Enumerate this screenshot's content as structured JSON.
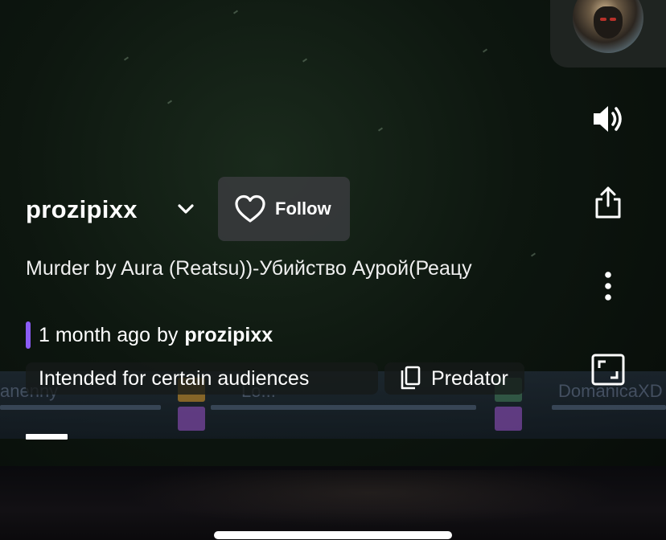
{
  "channel": {
    "username": "prozipixx",
    "follow_label": "Follow"
  },
  "clip": {
    "title": "Murder by Aura (Reatsu))-Убийство Аурой(Реацу",
    "age": "1 month ago",
    "by_label": "by",
    "clipped_by": "prozipixx"
  },
  "tags": {
    "audience": "Intended for certain audiences",
    "game": "Predator"
  },
  "hud_ghost_text": {
    "left": "anenny",
    "middle": "Lo...",
    "right": "DomanicaXD"
  },
  "rail": {
    "icons": [
      "avatar",
      "volume-icon",
      "share-icon",
      "more-icon",
      "fullscreen-icon"
    ]
  },
  "playback_progress": 0.08,
  "colors": {
    "accent": "#8b5cf6",
    "follow_button_bg": "#3a3c40",
    "text": "#ffffff"
  }
}
